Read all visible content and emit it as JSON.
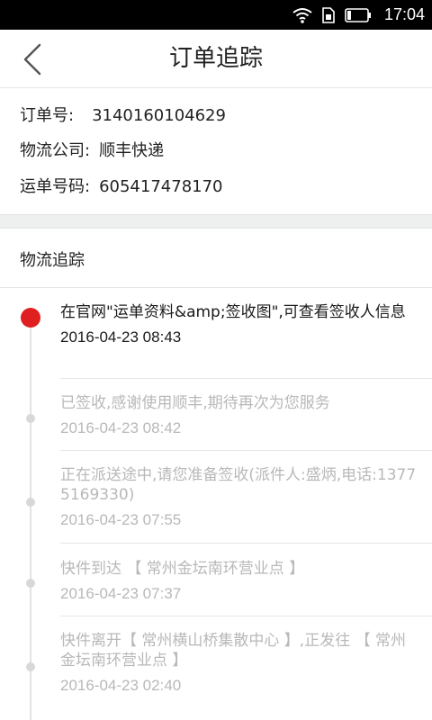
{
  "status_bar": {
    "time": "17:04"
  },
  "header": {
    "title": "订单追踪"
  },
  "order": {
    "order_no_label": "订单号:",
    "order_no": "3140160104629",
    "company_label": "物流公司:",
    "company": "顺丰快递",
    "waybill_label": "运单号码:",
    "waybill_no": "605417478170"
  },
  "tracking": {
    "title": "物流追踪",
    "events": [
      {
        "text": "在官网\"运单资料&amp;签收图\",可查看签收人信息",
        "time": "2016-04-23 08:43"
      },
      {
        "text": "已签收,感谢使用顺丰,期待再次为您服务",
        "time": "2016-04-23 08:42"
      },
      {
        "text": "正在派送途中,请您准备签收(派件人:盛炳,电话:13775169330)",
        "time": "2016-04-23 07:55"
      },
      {
        "text": "快件到达 【 常州金坛南环营业点 】",
        "time": "2016-04-23 07:37"
      },
      {
        "text": "快件离开【 常州横山桥集散中心 】,正发往 【 常州金坛南环营业点 】",
        "time": "2016-04-23 02:40"
      }
    ]
  }
}
